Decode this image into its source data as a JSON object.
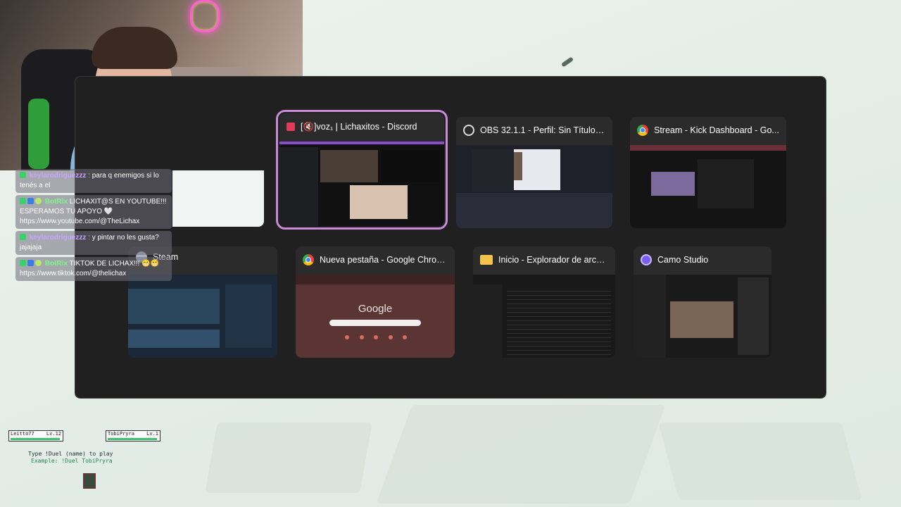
{
  "switcher": {
    "windows": [
      {
        "title": "[🔇]voz₁ | Lichaxitos - Discord",
        "icon": "discord-icon",
        "active": true
      },
      {
        "title": "OBS 32.1.1 - Perfil: Sin Título -...",
        "icon": "obs-icon"
      },
      {
        "title": "Stream - Kick Dashboard - Go...",
        "icon": "chrome-icon"
      },
      {
        "title": "Steam",
        "icon": "steam-icon"
      },
      {
        "title": "Nueva pestaña - Google Chrome",
        "icon": "chrome-icon",
        "thumb_text": "Google"
      },
      {
        "title": "Inicio - Explorador de archi...",
        "icon": "folder-icon"
      },
      {
        "title": "Camo Studio",
        "icon": "camo-icon"
      }
    ]
  },
  "chat": {
    "messages": [
      {
        "user": "keylarodriguezzz",
        "text": ": para q enemigos si lo tenés a el",
        "color": "#c9a4ff"
      },
      {
        "user": "BotRix",
        "text": "LICHAXIT@S EN YOUTUBE!!! ESPERAMOS TU APOYO 🤍 https://www.youtube.com/@TheLichax",
        "color": "#7cf58a"
      },
      {
        "user": "keylarodriguezzz",
        "text": ": y pintar no les gusta? jajajaja",
        "color": "#c9a4ff"
      },
      {
        "user": "BotRix",
        "text": "TIKTOK DE LICHAX!!! 😁😁 https://www.tiktok.com/@thelichax",
        "color": "#7cf58a"
      }
    ]
  },
  "game": {
    "player1": {
      "name": "Leitto77",
      "level": "Lv.12"
    },
    "player2": {
      "name": "TobiPryra",
      "level": "Lv.1"
    },
    "hint1": "Type !Duel (name) to play",
    "hint2": "Example: !Duel TobiPryra"
  }
}
